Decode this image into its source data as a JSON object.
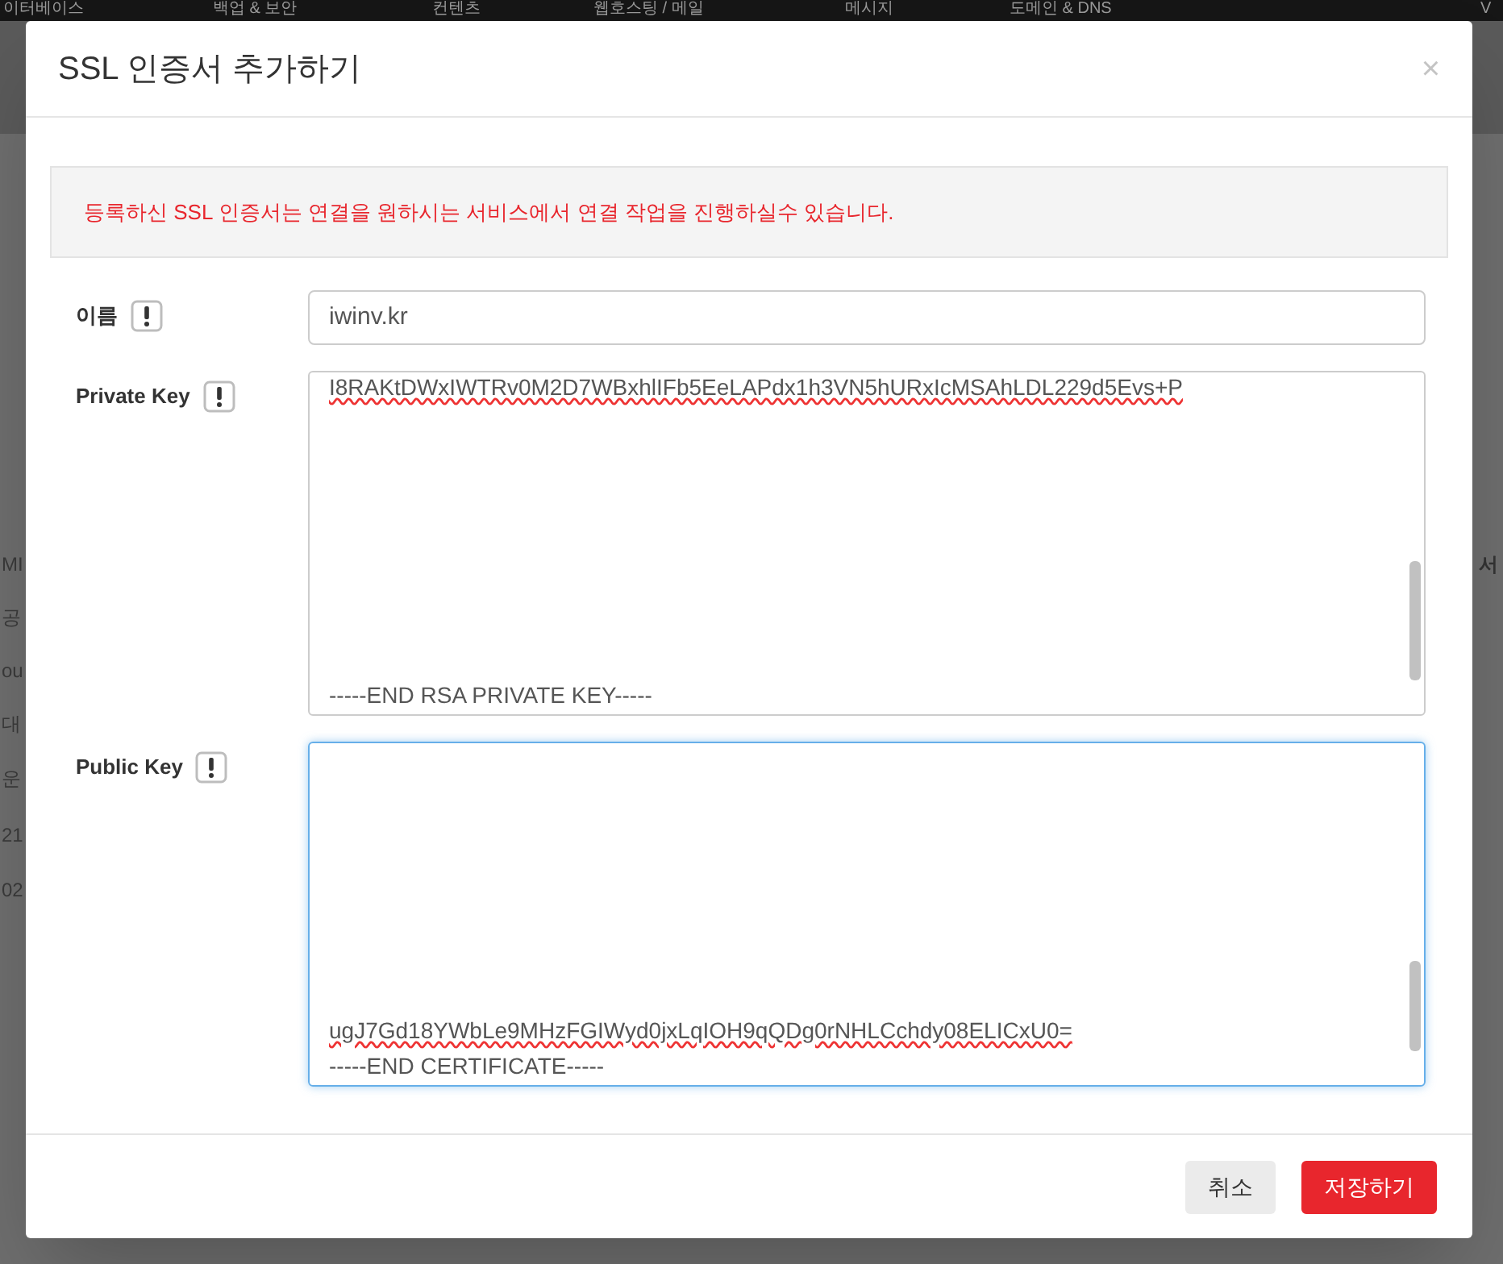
{
  "background": {
    "nav": [
      "이터베이스",
      "백업 & 보안",
      "컨텐츠",
      "웹호스팅 / 메일",
      "메시지",
      "도메인 & DNS",
      "V"
    ],
    "side_texts": [
      "MI",
      "공",
      "ou",
      "대",
      "운",
      "21",
      "02"
    ],
    "right_text": "서"
  },
  "dialog": {
    "title": "SSL 인증서 추가하기",
    "close": "×",
    "notice": "등록하신 SSL 인증서는 연결을 원하시는 서비스에서 연결 작업을 진행하실수 있습니다.",
    "fields": [
      {
        "label": "이름",
        "kind": "input",
        "value": "iwinv.kr",
        "focused": false
      },
      {
        "label": "Private Key",
        "kind": "textarea",
        "top_line": "I8RAKtDWxIWTRv0M2D7WBxhlIFb5EeLAPdx1h3VN5hURxIcMSAhLDL229d5Evs+P",
        "lines": [
          "-----END RSA PRIVATE KEY-----"
        ],
        "focused": false
      },
      {
        "label": "Public Key",
        "kind": "textarea",
        "lines": [
          "ugJ7Gd18YWbLe9MHzFGIWyd0jxLqIOH9qQDg0rNHLCchdy08ELICxU0=",
          "-----END CERTIFICATE-----"
        ],
        "focused": true
      }
    ],
    "buttons": [
      {
        "label": "취소",
        "kind": "secondary"
      },
      {
        "label": "저장하기",
        "kind": "primary"
      }
    ]
  }
}
